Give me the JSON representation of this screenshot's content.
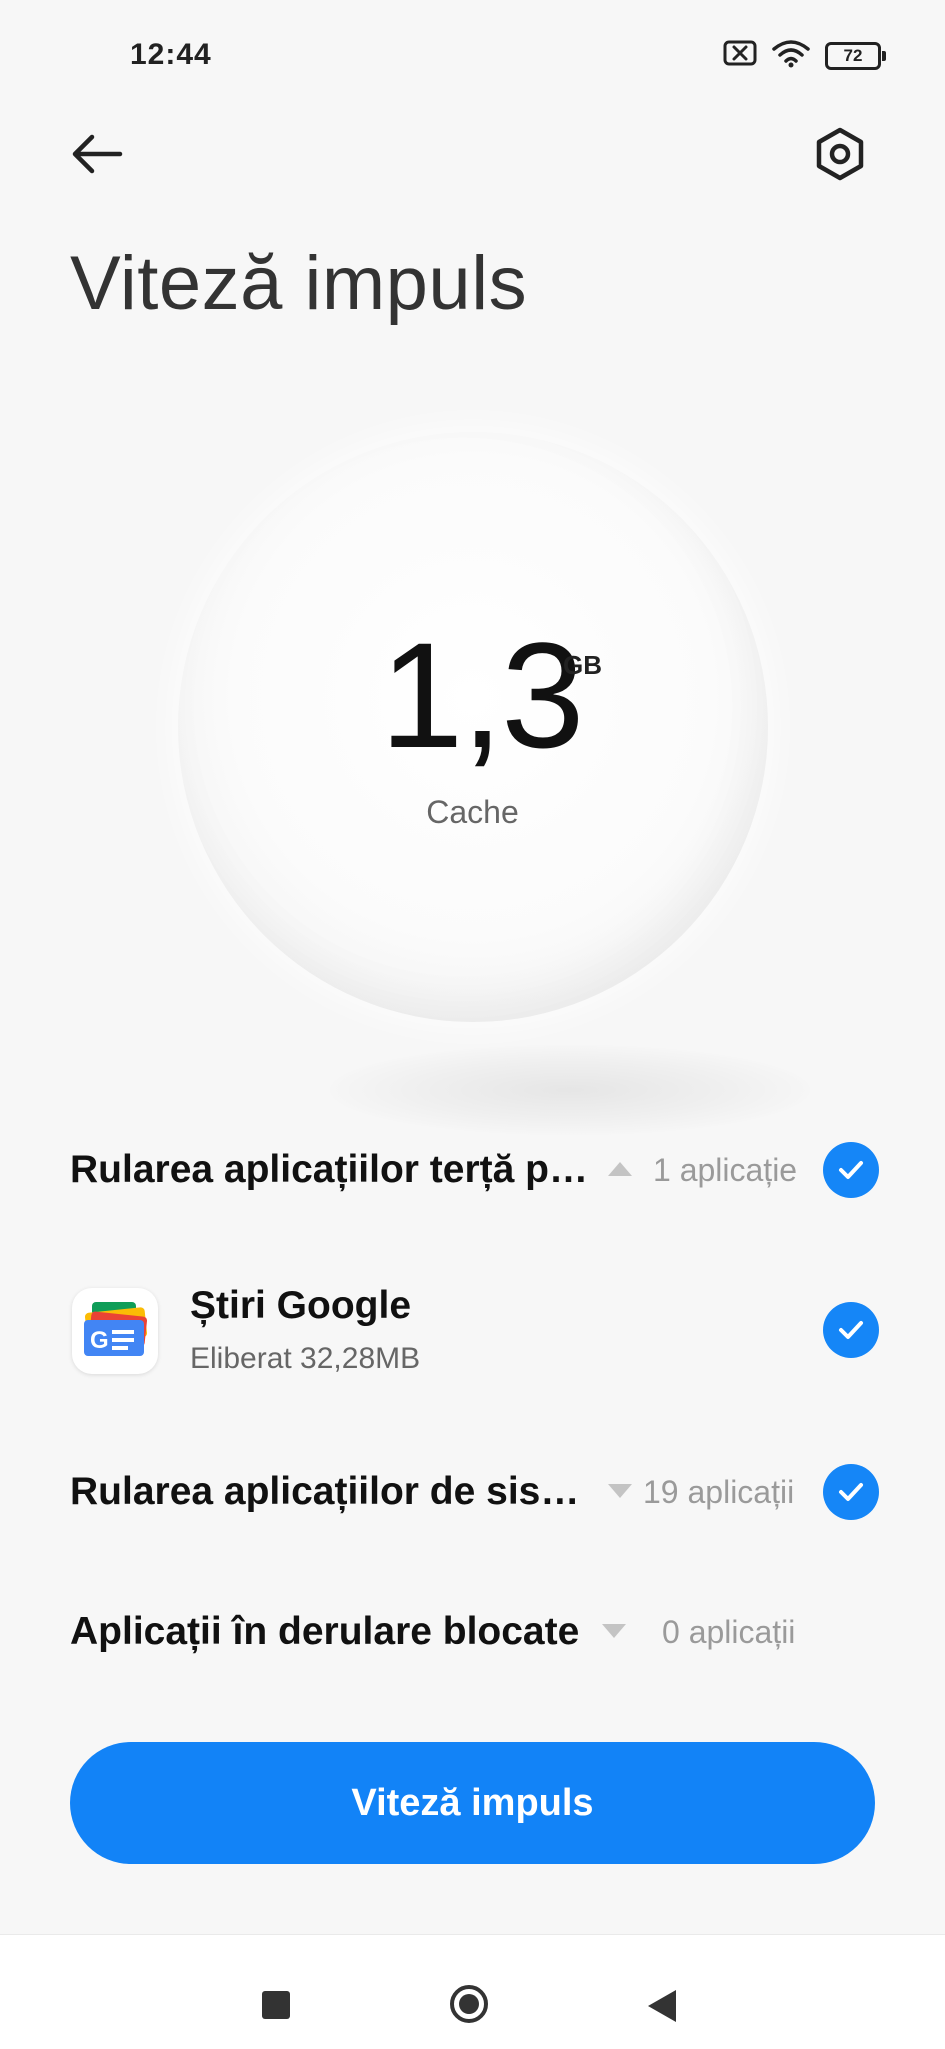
{
  "status_bar": {
    "time": "12:44",
    "battery_level": "72",
    "icons": [
      "close-box-icon",
      "wifi-icon",
      "battery-icon"
    ]
  },
  "header": {
    "back_icon": "arrow-left-icon",
    "settings_icon": "hexagon-settings-icon"
  },
  "page_title": "Viteză impuls",
  "cache": {
    "value": "1,3",
    "unit": "GB",
    "label": "Cache"
  },
  "sections": [
    {
      "title": "Rularea aplicațiilor terță p…",
      "expanded": true,
      "count": "1 aplicație",
      "checked": true
    },
    {
      "title": "Rularea aplicațiilor de sis…",
      "expanded": false,
      "count": "19 aplicații",
      "checked": true
    },
    {
      "title": "Aplicații în derulare blocate",
      "expanded": false,
      "count": "0 aplicații",
      "checked": false
    }
  ],
  "apps": [
    {
      "name": "Știri Google",
      "freed": "Eliberat 32,28MB",
      "icon": "google-news-icon",
      "checked": true
    }
  ],
  "boost_button": {
    "label": "Viteză impuls"
  },
  "colors": {
    "accent": "#1586f7",
    "background": "#f7f7f7",
    "title_text": "#333333",
    "secondary_text": "#9a9a9a"
  }
}
